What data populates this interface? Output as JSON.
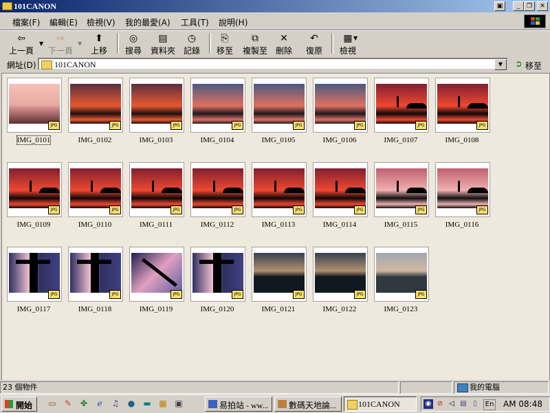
{
  "window": {
    "title": "101CANON"
  },
  "menu": [
    "檔案(F)",
    "編輯(E)",
    "檢視(V)",
    "我的最愛(A)",
    "工具(T)",
    "說明(H)"
  ],
  "toolbar": {
    "back": "上一頁",
    "forward": "下一頁",
    "up": "上移",
    "search": "搜尋",
    "folders": "資料夾",
    "history": "記錄",
    "move_to": "移至",
    "copy_to": "複製至",
    "delete": "刪除",
    "undo": "復原",
    "views": "檢視"
  },
  "address": {
    "label": "網址(D)",
    "value": "101CANON",
    "go": "移至"
  },
  "files": [
    {
      "name": "IMG_0101",
      "scene": "shore"
    },
    {
      "name": "IMG_0102",
      "scene": "sunset"
    },
    {
      "name": "IMG_0103",
      "scene": "sunset"
    },
    {
      "name": "IMG_0104",
      "scene": "sunsetblue"
    },
    {
      "name": "IMG_0105",
      "scene": "sunsetblue"
    },
    {
      "name": "IMG_0106",
      "scene": "sunsetblue"
    },
    {
      "name": "IMG_0107",
      "scene": "figure"
    },
    {
      "name": "IMG_0108",
      "scene": "figure"
    },
    {
      "name": "IMG_0109",
      "scene": "figure"
    },
    {
      "name": "IMG_0110",
      "scene": "figure"
    },
    {
      "name": "IMG_0111",
      "scene": "figure"
    },
    {
      "name": "IMG_0112",
      "scene": "figure"
    },
    {
      "name": "IMG_0113",
      "scene": "figure"
    },
    {
      "name": "IMG_0114",
      "scene": "figure"
    },
    {
      "name": "IMG_0115",
      "scene": "figurepink"
    },
    {
      "name": "IMG_0116",
      "scene": "figurepink"
    },
    {
      "name": "IMG_0117",
      "scene": "rotated"
    },
    {
      "name": "IMG_0118",
      "scene": "rotated"
    },
    {
      "name": "IMG_0119",
      "scene": "diagonal"
    },
    {
      "name": "IMG_0120",
      "scene": "rotated"
    },
    {
      "name": "IMG_0121",
      "scene": "dusk"
    },
    {
      "name": "IMG_0122",
      "scene": "dusk"
    },
    {
      "name": "IMG_0123",
      "scene": "dusklight"
    }
  ],
  "badge": "JPG",
  "status": {
    "count": "23 個物件",
    "location": "我的電腦"
  },
  "taskbar": {
    "start": "開始",
    "tasks": [
      "易拍站 - ww...",
      "數碼天地論...",
      "101CANON"
    ],
    "tray_lang": "En",
    "clock": "AM 08:48"
  },
  "colors": {
    "title_gradient": [
      "#0a246a",
      "#a6caf0"
    ],
    "face": "#d4d0c8",
    "pane": "#efe9dd"
  }
}
